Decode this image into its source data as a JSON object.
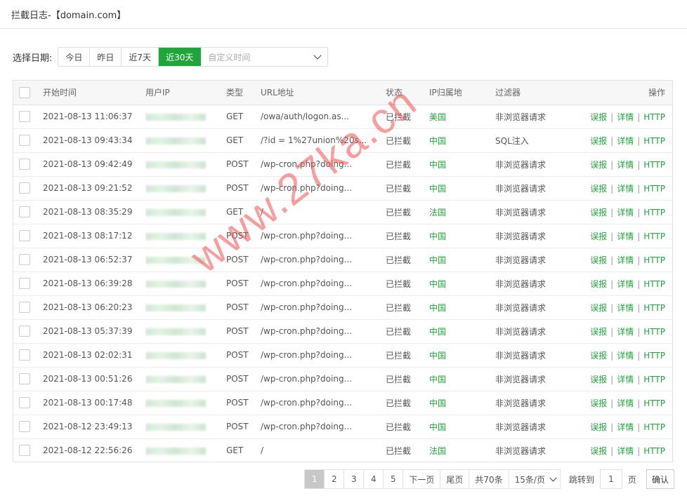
{
  "header": {
    "title": "拦截日志-【domain.com】"
  },
  "date_filter": {
    "label": "选择日期:",
    "options": [
      "今日",
      "昨日",
      "近7天",
      "近30天"
    ],
    "active_index": 3,
    "custom_placeholder": "自定义时间"
  },
  "table": {
    "columns": [
      "开始时间",
      "用户IP",
      "类型",
      "URL地址",
      "状态",
      "IP归属地",
      "过滤器",
      "操作"
    ],
    "actions": {
      "report": "误报",
      "detail": "详情",
      "http": "HTTP"
    },
    "rows": [
      {
        "time": "2021-08-13 11:06:37",
        "method": "GET",
        "url": "/owa/auth/logon.as...",
        "status": "已拦截",
        "location": "美国",
        "filter": "非浏览器请求"
      },
      {
        "time": "2021-08-13 09:43:34",
        "method": "GET",
        "url": "/?id = 1%27union%20s...",
        "status": "已拦截",
        "location": "中国",
        "filter": "SQL注入"
      },
      {
        "time": "2021-08-13 09:42:49",
        "method": "POST",
        "url": "/wp-cron.php?doing...",
        "status": "已拦截",
        "location": "中国",
        "filter": "非浏览器请求"
      },
      {
        "time": "2021-08-13 09:21:52",
        "method": "POST",
        "url": "/wp-cron.php?doing...",
        "status": "已拦截",
        "location": "中国",
        "filter": "非浏览器请求"
      },
      {
        "time": "2021-08-13 08:35:29",
        "method": "GET",
        "url": "/",
        "status": "已拦截",
        "location": "法国",
        "filter": "非浏览器请求"
      },
      {
        "time": "2021-08-13 08:17:12",
        "method": "POST",
        "url": "/wp-cron.php?doing...",
        "status": "已拦截",
        "location": "中国",
        "filter": "非浏览器请求"
      },
      {
        "time": "2021-08-13 06:52:37",
        "method": "POST",
        "url": "/wp-cron.php?doing...",
        "status": "已拦截",
        "location": "中国",
        "filter": "非浏览器请求"
      },
      {
        "time": "2021-08-13 06:39:28",
        "method": "POST",
        "url": "/wp-cron.php?doing...",
        "status": "已拦截",
        "location": "中国",
        "filter": "非浏览器请求"
      },
      {
        "time": "2021-08-13 06:20:23",
        "method": "POST",
        "url": "/wp-cron.php?doing...",
        "status": "已拦截",
        "location": "中国",
        "filter": "非浏览器请求"
      },
      {
        "time": "2021-08-13 05:37:39",
        "method": "POST",
        "url": "/wp-cron.php?doing...",
        "status": "已拦截",
        "location": "中国",
        "filter": "非浏览器请求"
      },
      {
        "time": "2021-08-13 02:02:31",
        "method": "POST",
        "url": "/wp-cron.php?doing...",
        "status": "已拦截",
        "location": "中国",
        "filter": "非浏览器请求"
      },
      {
        "time": "2021-08-13 00:51:26",
        "method": "POST",
        "url": "/wp-cron.php?doing...",
        "status": "已拦截",
        "location": "中国",
        "filter": "非浏览器请求"
      },
      {
        "time": "2021-08-13 00:17:48",
        "method": "POST",
        "url": "/wp-cron.php?doing...",
        "status": "已拦截",
        "location": "中国",
        "filter": "非浏览器请求"
      },
      {
        "time": "2021-08-12 23:49:13",
        "method": "POST",
        "url": "/wp-cron.php?doing...",
        "status": "已拦截",
        "location": "中国",
        "filter": "非浏览器请求"
      },
      {
        "time": "2021-08-12 22:56:26",
        "method": "GET",
        "url": "/",
        "status": "已拦截",
        "location": "法国",
        "filter": "非浏览器请求"
      }
    ]
  },
  "pagination": {
    "pages": [
      "1",
      "2",
      "3",
      "4",
      "5"
    ],
    "current": "1",
    "next": "下一页",
    "last": "尾页",
    "total": "共70条",
    "page_size": "15条/页",
    "jump_label": "跳转到",
    "jump_value": "1",
    "page_unit": "页",
    "confirm": "确认"
  },
  "watermark": "www.27ka.cn",
  "colors": {
    "accent": "#20a53a",
    "watermark": "#f05050"
  }
}
